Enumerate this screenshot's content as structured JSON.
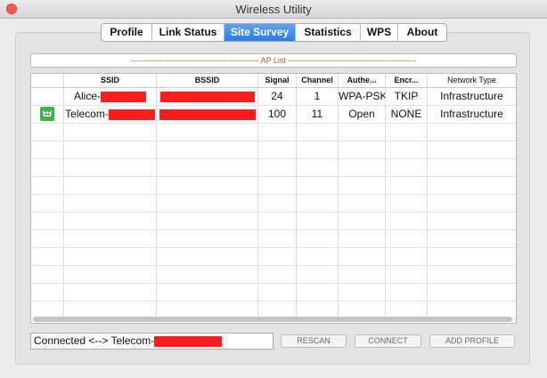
{
  "window": {
    "title": "Wireless Utility"
  },
  "tabs": [
    {
      "label": "Profile",
      "active": false
    },
    {
      "label": "Link Status",
      "active": false
    },
    {
      "label": "Site Survey",
      "active": true
    },
    {
      "label": "Statistics",
      "active": false
    },
    {
      "label": "WPS",
      "active": false
    },
    {
      "label": "About",
      "active": false
    }
  ],
  "ap_list": {
    "title": "------------------------------------------------ AP List ------------------------------------------------",
    "headers": [
      "",
      "SSID",
      "BSSID",
      "Signal",
      "Channel",
      "Authe...",
      "Encr...",
      "Network Type"
    ],
    "rows": [
      {
        "ssid": "Alice-",
        "signal": "24",
        "channel": "1",
        "auth": "WPA-PSK",
        "encr": "TKIP",
        "network_type": "Infrastructure",
        "connected": false
      },
      {
        "ssid": "Telecom-",
        "signal": "100",
        "channel": "11",
        "auth": "Open",
        "encr": "NONE",
        "network_type": "Infrastructure",
        "connected": true
      }
    ],
    "empty_rows": 11
  },
  "status": {
    "text": "Connected <--> Telecom-"
  },
  "buttons": {
    "rescan": "RESCAN",
    "connect": "CONNECT",
    "add_profile": "ADD PROFILE"
  },
  "colors": {
    "accent": "#2c7de8",
    "redaction": "#ff1c1c",
    "connected_icon": "#3bb54a"
  }
}
